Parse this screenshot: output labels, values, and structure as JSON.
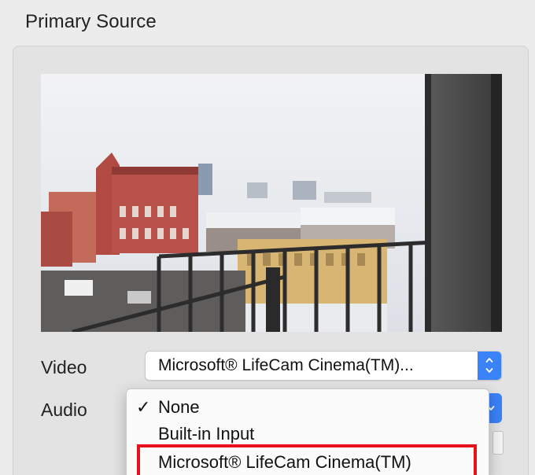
{
  "section": {
    "title": "Primary Source"
  },
  "video": {
    "label": "Video",
    "selected": "Microsoft® LifeCam Cinema(TM)..."
  },
  "audio": {
    "label": "Audio",
    "menu_items": [
      {
        "label": "None",
        "checked": true,
        "check_glyph": "✓"
      },
      {
        "label": "Built-in Input",
        "checked": false,
        "check_glyph": ""
      },
      {
        "label": "Microsoft® LifeCam Cinema(TM)",
        "checked": false,
        "check_glyph": ""
      }
    ]
  },
  "colors": {
    "accent_blue": "#3a82f7",
    "highlight_red": "#e8101a",
    "window_bg": "#ececec"
  },
  "icons": {
    "popup_stepper": "chevron-up-down-icon",
    "menu_check": "checkmark-icon"
  }
}
